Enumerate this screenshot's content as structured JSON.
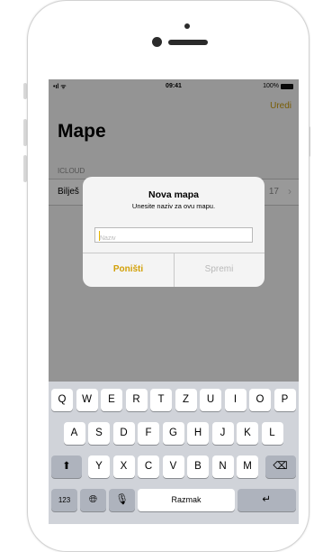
{
  "status_bar": {
    "signal": "•ıl ᯤ",
    "time": "09:41",
    "battery": "100%"
  },
  "header": {
    "edit_label": "Uredi",
    "title": "Mape"
  },
  "list": {
    "section": "ICLOUD",
    "rows": [
      {
        "label": "Bilješ",
        "count": "17"
      }
    ]
  },
  "alert": {
    "title": "Nova mapa",
    "message": "Unesite naziv za ovu mapu.",
    "input_placeholder": "Naziv",
    "input_value": "",
    "cancel_label": "Poništi",
    "save_label": "Spremi"
  },
  "keyboard": {
    "row1": [
      "Q",
      "W",
      "E",
      "R",
      "T",
      "Z",
      "U",
      "I",
      "O",
      "P"
    ],
    "row2": [
      "A",
      "S",
      "D",
      "F",
      "G",
      "H",
      "J",
      "K",
      "L"
    ],
    "row3": [
      "Y",
      "X",
      "C",
      "V",
      "B",
      "N",
      "M"
    ],
    "numbers_label": "123",
    "globe_icon": "globe-icon",
    "mic_icon": "microphone-icon",
    "space_label": "Razmak",
    "shift_icon": "shift-icon",
    "backspace_icon": "backspace-icon",
    "return_icon": "return-icon",
    "accent_color": "#d2a007"
  }
}
